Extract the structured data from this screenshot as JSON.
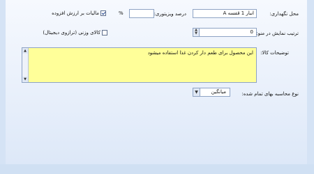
{
  "form": {
    "storage_label": "محل نگهداری:",
    "storage_value": "انبار 1 قفسه A",
    "special_percent_label": "درصد ویزیتوری:",
    "special_percent_value": "",
    "percent_symbol": "%",
    "vat_label": "مالیات بر ارزش افزوده",
    "vat_checked": true,
    "display_order_label": "ترتیب نمایش در منو:",
    "display_order_value": "0",
    "weighted_label": "کالای وزنی (ترازوی دیجیتال)",
    "weighted_checked": false,
    "description_label": "توضیحات کالا:",
    "description_value": "این محصول برای طعم دار کردن غذا استفاده میشود",
    "cost_method_label": "نوع محاسبه بهای تمام شده:",
    "cost_method_value": "میانگین"
  },
  "icons": {
    "spin": "spin-arrows-icon",
    "dropdown": "chevron-down-icon",
    "scroll_up": "scroll-up-icon",
    "scroll_down": "scroll-down-icon"
  },
  "colors": {
    "background": "#d5e3f5",
    "memo_background": "#ffff99",
    "field_border": "#8ea3c4"
  }
}
